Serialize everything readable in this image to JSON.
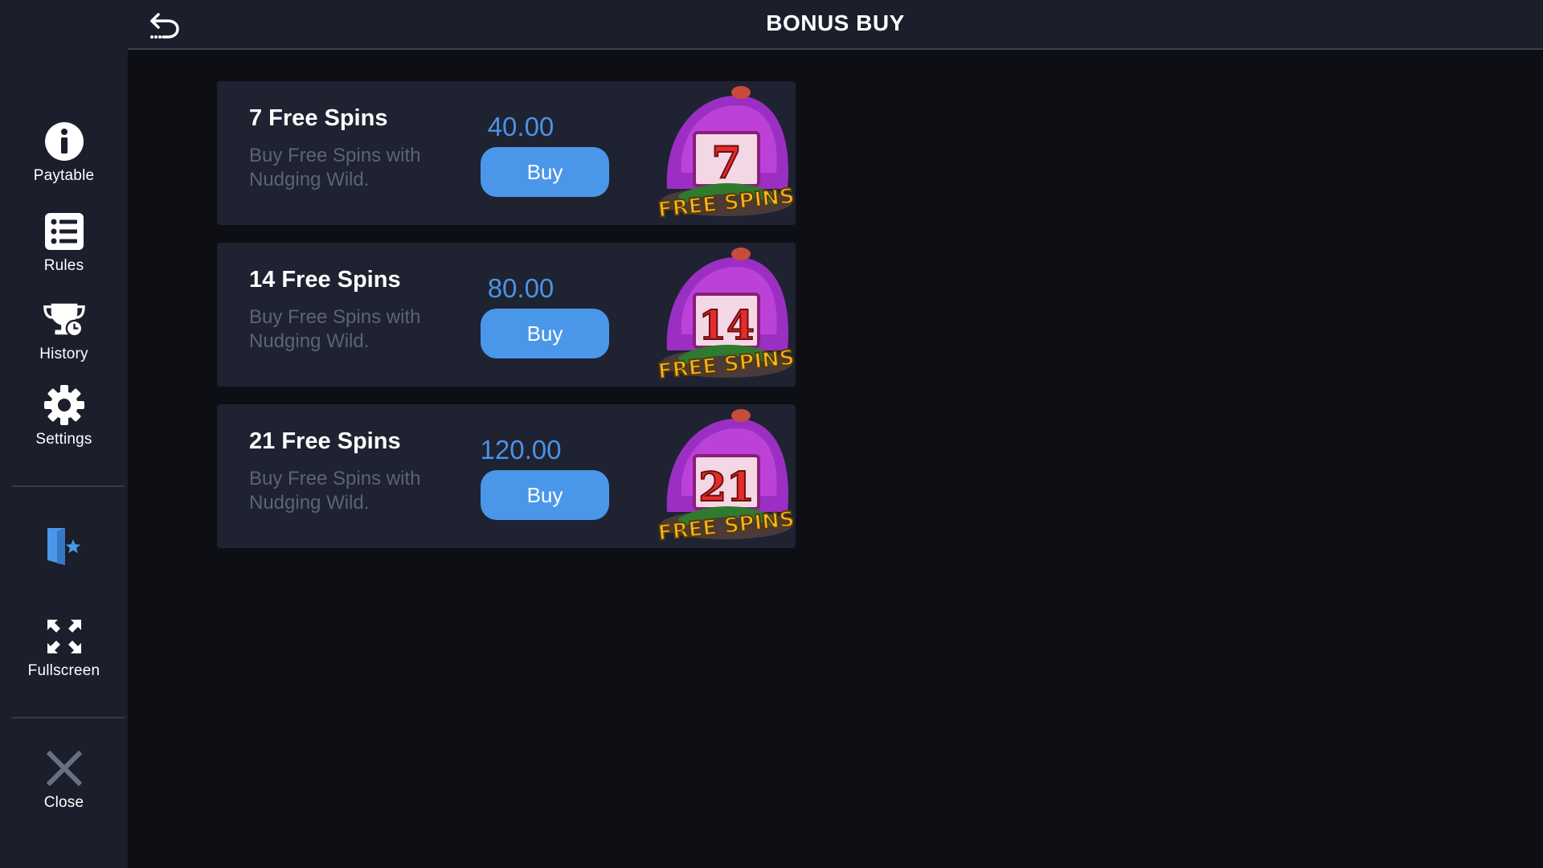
{
  "header": {
    "title": "BONUS BUY"
  },
  "sidebar": {
    "items": [
      {
        "label": "Paytable",
        "icon": "info-icon"
      },
      {
        "label": "Rules",
        "icon": "list-icon"
      },
      {
        "label": "History",
        "icon": "trophy-clock-icon"
      },
      {
        "label": "Settings",
        "icon": "gear-icon"
      },
      {
        "label": "",
        "icon": "door-star-icon"
      },
      {
        "label": "Fullscreen",
        "icon": "fullscreen-icon"
      },
      {
        "label": "Close",
        "icon": "close-icon"
      }
    ]
  },
  "offers": [
    {
      "title": "7 Free Spins",
      "description": "Buy Free Spins with Nudging Wild.",
      "price": "40.00 EUR",
      "button": "Buy",
      "badge_number": "7",
      "badge_text": "FREE SPINS"
    },
    {
      "title": "14 Free Spins",
      "description": "Buy Free Spins with Nudging Wild.",
      "price": "80.00 EUR",
      "button": "Buy",
      "badge_number": "14",
      "badge_text": "FREE SPINS"
    },
    {
      "title": "21 Free Spins",
      "description": "Buy Free Spins with Nudging Wild.",
      "price": "120.00 EUR",
      "button": "Buy",
      "badge_number": "21",
      "badge_text": "FREE SPINS"
    }
  ],
  "colors": {
    "accent": "#4a97ea",
    "price": "#4a93e6",
    "panel": "#1e2231",
    "sidebar": "#1b1e2b",
    "background": "#0e0f15",
    "badge_purple": "#9b2fc4",
    "badge_gold": "#f5b71f"
  }
}
